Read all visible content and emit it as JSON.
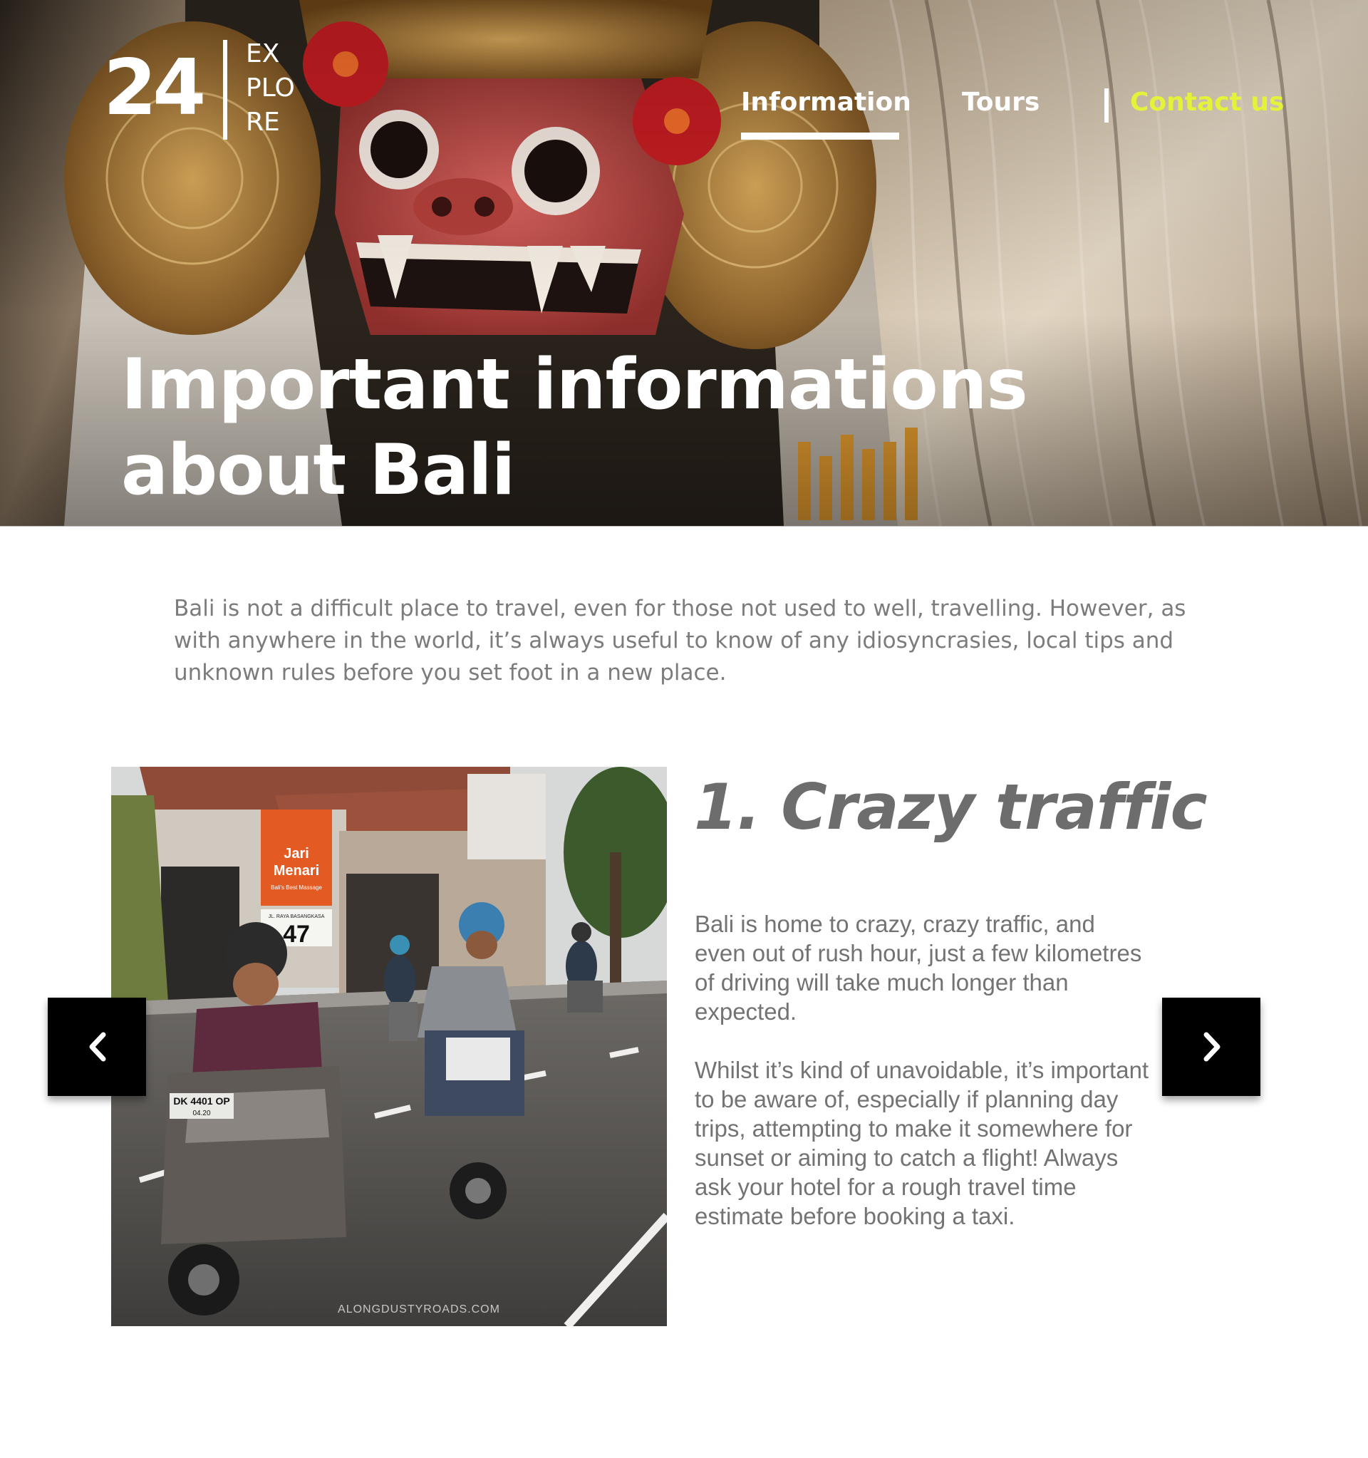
{
  "logo": {
    "number": "24",
    "word_lines": [
      "EX",
      "PLO",
      "RE"
    ]
  },
  "nav": {
    "items": [
      {
        "label": "Information",
        "active": true
      },
      {
        "label": "Tours",
        "active": false
      }
    ],
    "contact_label": "Contact us"
  },
  "hero": {
    "title_lines": [
      "Important informations",
      "about Bali"
    ]
  },
  "intro": {
    "text": "Bali is not a difficult place to travel, even for those not used to well, travelling. However, as with anywhere in the world, it’s always useful to know of any idiosyncrasies, local tips and unknown rules before you set foot in a new place."
  },
  "tip": {
    "title": "1. Crazy traffic",
    "paragraphs": [
      "Bali is home to crazy, crazy traffic, and even out of rush hour, just a few kilometres of driving will take much longer than expected.",
      "Whilst it’s kind of unavoidable, it’s important to be aware of, especially if planning day trips, attempting to make it somewhere for sunset or aiming to catch a flight! Always ask your hotel for a rough travel time estimate before booking a taxi."
    ],
    "photo": {
      "shop_sign_line1": "Jari",
      "shop_sign_line2": "Menari",
      "shop_sign_small": "Bali's Best Massage",
      "number_sign": "47",
      "street_sign": "JL. RAYA BASANGKASA",
      "plate_line1": "DK 4401 OP",
      "plate_line2": "04.20",
      "watermark": "ALONGDUSTYROADS.COM"
    }
  },
  "colors": {
    "accent": "#e4f33a",
    "body_text": "#737373",
    "intro_text": "#7c7c7c",
    "button_bg": "#000000"
  },
  "icons": {
    "prev": "chevron-left-icon",
    "next": "chevron-right-icon"
  }
}
